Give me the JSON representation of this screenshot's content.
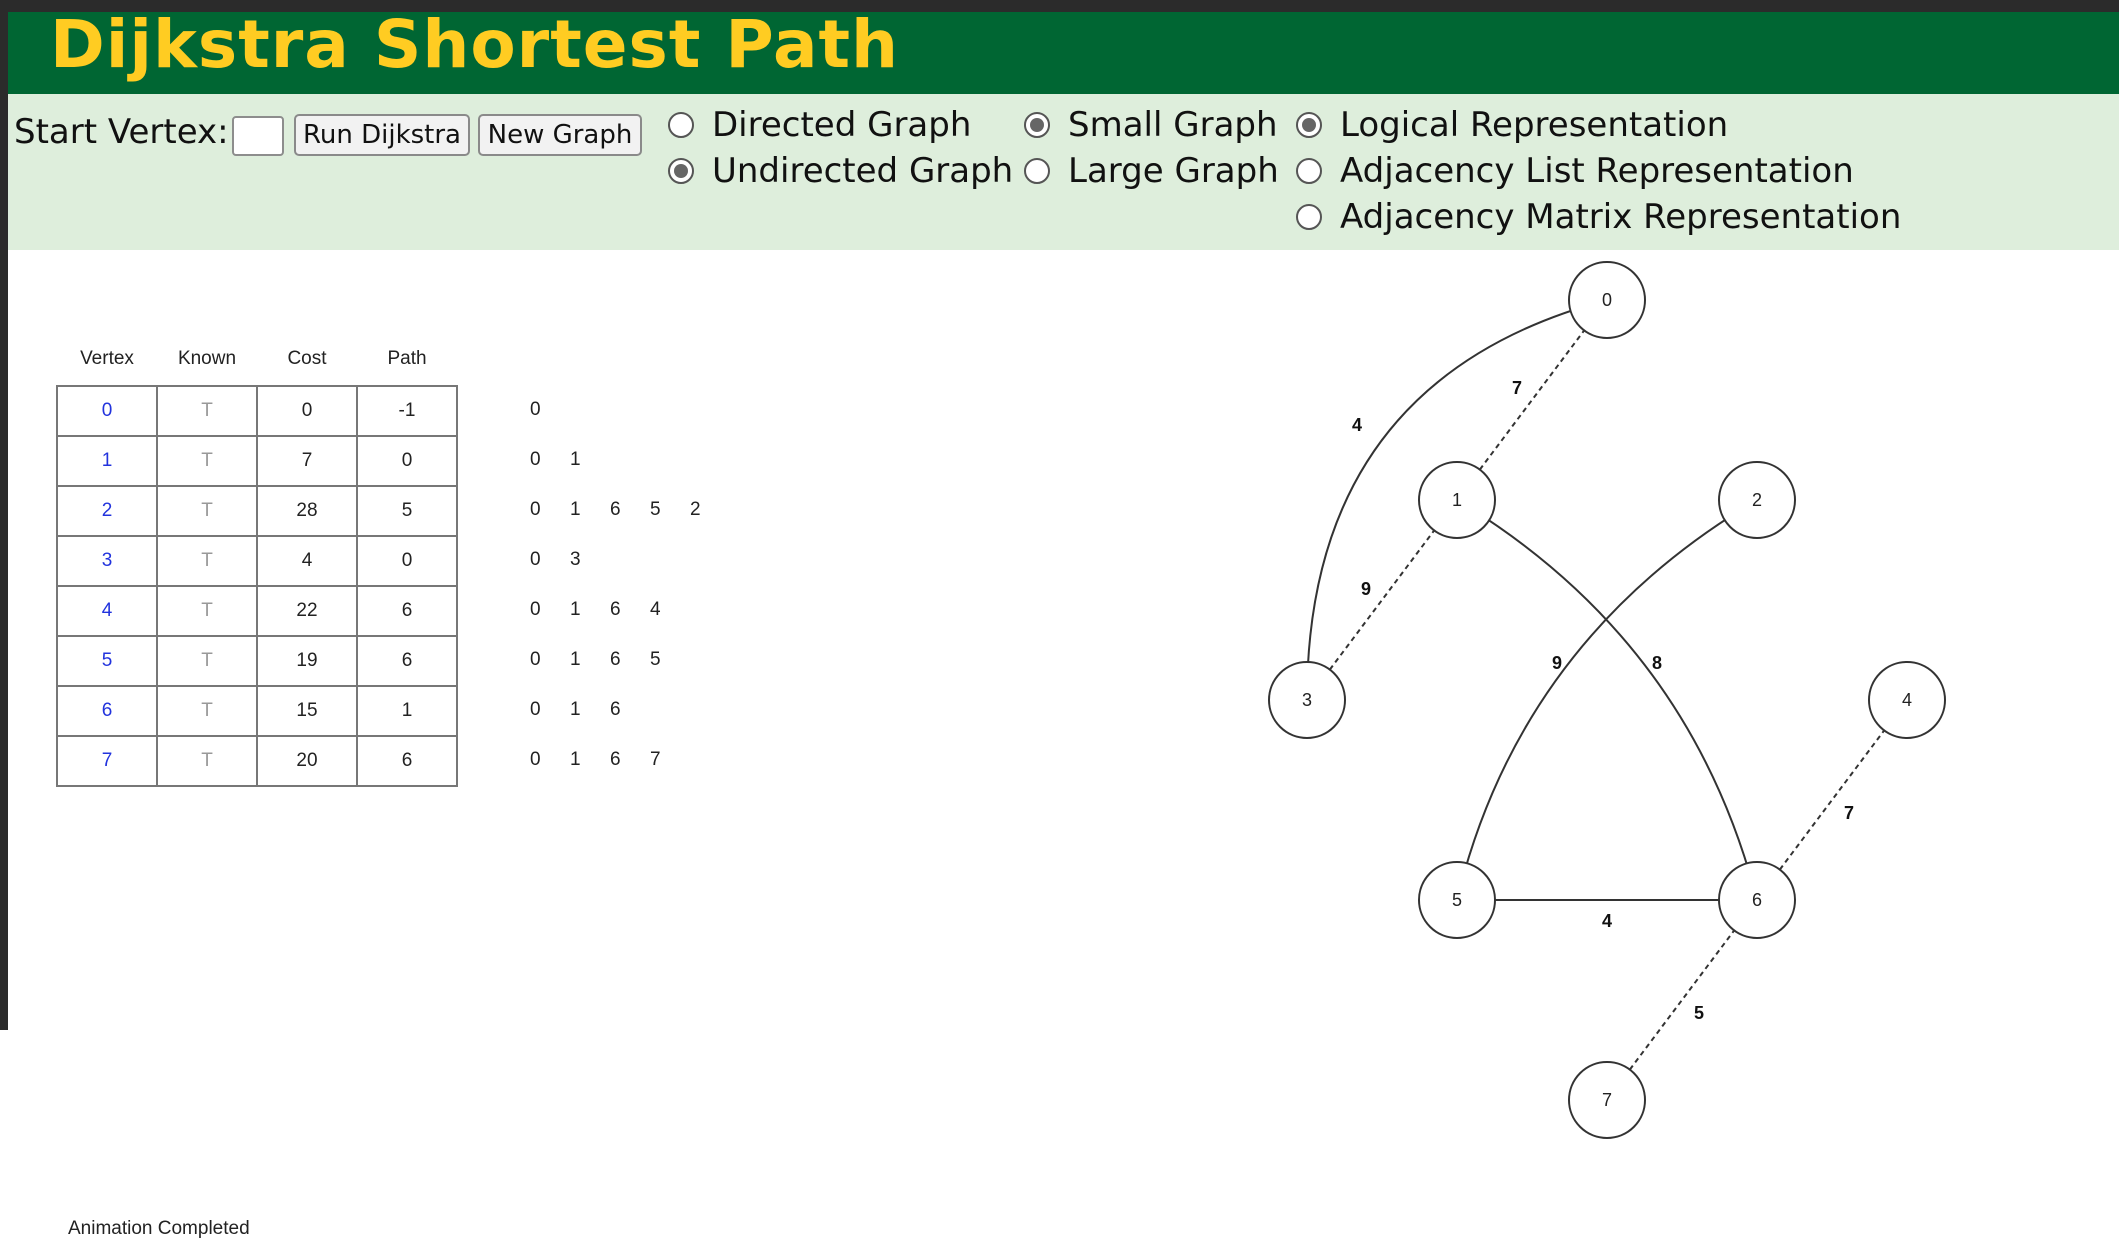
{
  "title": "Dijkstra Shortest Path",
  "controls": {
    "start_vertex_label": "Start Vertex:",
    "start_vertex_value": "",
    "run_button": "Run Dijkstra",
    "new_graph_button": "New Graph",
    "graph_direction": [
      {
        "label": "Directed Graph",
        "checked": false
      },
      {
        "label": "Undirected Graph",
        "checked": true
      }
    ],
    "graph_size": [
      {
        "label": "Small Graph",
        "checked": true
      },
      {
        "label": "Large Graph",
        "checked": false
      }
    ],
    "representation": [
      {
        "label": "Logical Representation",
        "checked": true
      },
      {
        "label": "Adjacency List Representation",
        "checked": false
      },
      {
        "label": "Adjacency Matrix Representation",
        "checked": false
      }
    ]
  },
  "table": {
    "headers": [
      "Vertex",
      "Known",
      "Cost",
      "Path"
    ],
    "rows": [
      [
        "0",
        "T",
        "0",
        "-1"
      ],
      [
        "1",
        "T",
        "7",
        "0"
      ],
      [
        "2",
        "T",
        "28",
        "5"
      ],
      [
        "3",
        "T",
        "4",
        "0"
      ],
      [
        "4",
        "T",
        "22",
        "6"
      ],
      [
        "5",
        "T",
        "19",
        "6"
      ],
      [
        "6",
        "T",
        "15",
        "1"
      ],
      [
        "7",
        "T",
        "20",
        "6"
      ]
    ]
  },
  "paths": [
    [
      "0"
    ],
    [
      "0",
      "1"
    ],
    [
      "0",
      "1",
      "6",
      "5",
      "2"
    ],
    [
      "0",
      "3"
    ],
    [
      "0",
      "1",
      "6",
      "4"
    ],
    [
      "0",
      "1",
      "6",
      "5"
    ],
    [
      "0",
      "1",
      "6"
    ],
    [
      "0",
      "1",
      "6",
      "7"
    ]
  ],
  "status": "Animation Completed",
  "graph": {
    "vertices": [
      "0",
      "1",
      "2",
      "3",
      "4",
      "5",
      "6",
      "7"
    ],
    "edges": [
      {
        "from": "0",
        "to": "1",
        "weight": "7"
      },
      {
        "from": "0",
        "to": "3",
        "weight": "4"
      },
      {
        "from": "1",
        "to": "3",
        "weight": "9"
      },
      {
        "from": "1",
        "to": "6",
        "weight": "8"
      },
      {
        "from": "2",
        "to": "5",
        "weight": "9"
      },
      {
        "from": "4",
        "to": "6",
        "weight": "7"
      },
      {
        "from": "5",
        "to": "6",
        "weight": "4"
      },
      {
        "from": "6",
        "to": "7",
        "weight": "5"
      }
    ]
  }
}
